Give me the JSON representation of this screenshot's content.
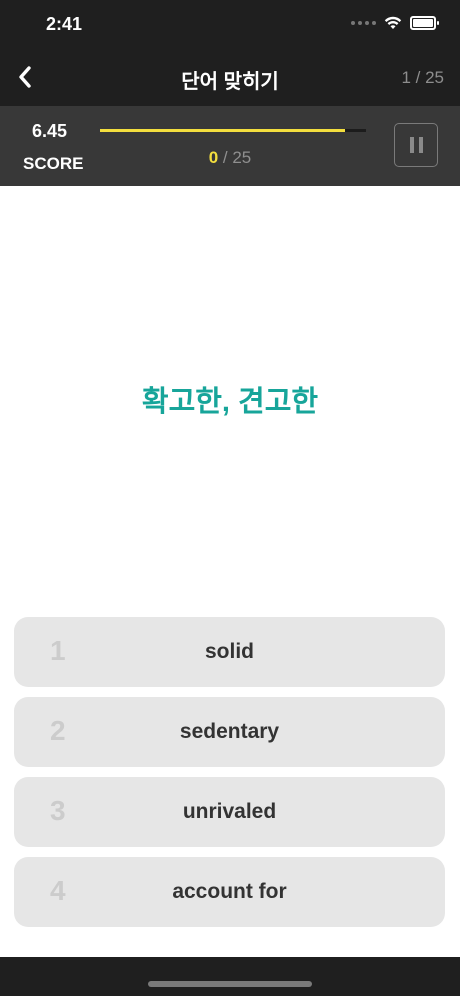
{
  "status_bar": {
    "time": "2:41"
  },
  "nav": {
    "title": "단어 맞히기",
    "counter": "1 / 25"
  },
  "score": {
    "value": "6.45",
    "label": "SCORE",
    "progress_fraction": 0.92,
    "correct": "0",
    "total": " / 25"
  },
  "question": {
    "text": "확고한, 견고한"
  },
  "options": [
    {
      "number": "1",
      "label": "solid"
    },
    {
      "number": "2",
      "label": "sedentary"
    },
    {
      "number": "3",
      "label": "unrivaled"
    },
    {
      "number": "4",
      "label": "account for"
    }
  ],
  "icons": {
    "back": "chevron-left-icon",
    "pause": "pause-icon",
    "wifi": "wifi-icon",
    "battery": "battery-icon",
    "signal": "signal-icon"
  },
  "colors": {
    "accent_text": "#17a59a",
    "progress": "#f3de3e",
    "header_bg": "#1f1f1f",
    "score_bg": "#383838",
    "option_bg": "#e6e6e6"
  }
}
